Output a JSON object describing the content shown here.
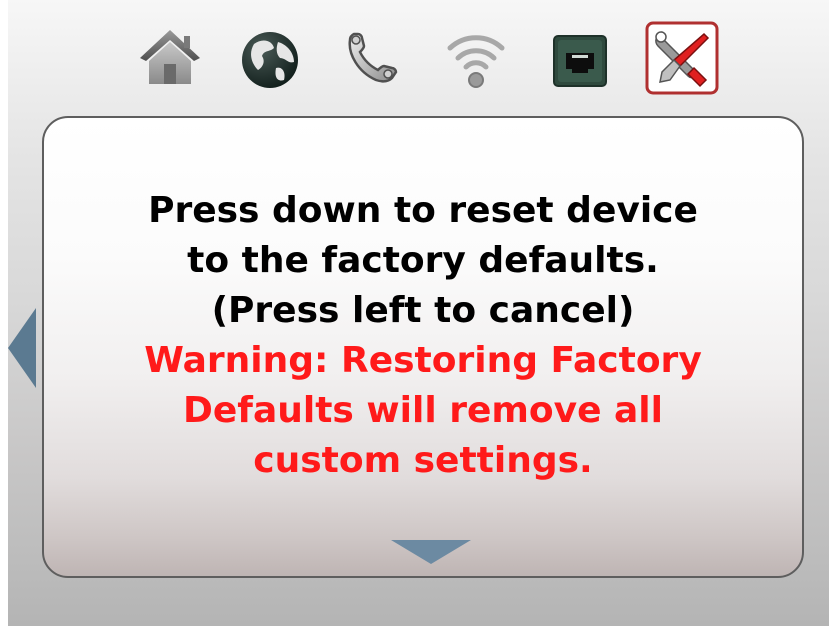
{
  "nav": {
    "icons": [
      "home-icon",
      "globe-icon",
      "phone-icon",
      "wifi-icon",
      "ethernet-port-icon",
      "tools-icon"
    ],
    "selected": "tools-icon"
  },
  "dialog": {
    "line1": "Press down to reset device",
    "line2": "to the factory defaults.",
    "line3": "(Press left to cancel)",
    "warning_line1": "Warning: Restoring Factory",
    "warning_line2": "Defaults will remove all",
    "warning_line3": "custom settings."
  },
  "colors": {
    "text": "#000000",
    "warning": "#ff1a1a",
    "arrow": "#5b7a91",
    "selected_border": "#b03030"
  }
}
